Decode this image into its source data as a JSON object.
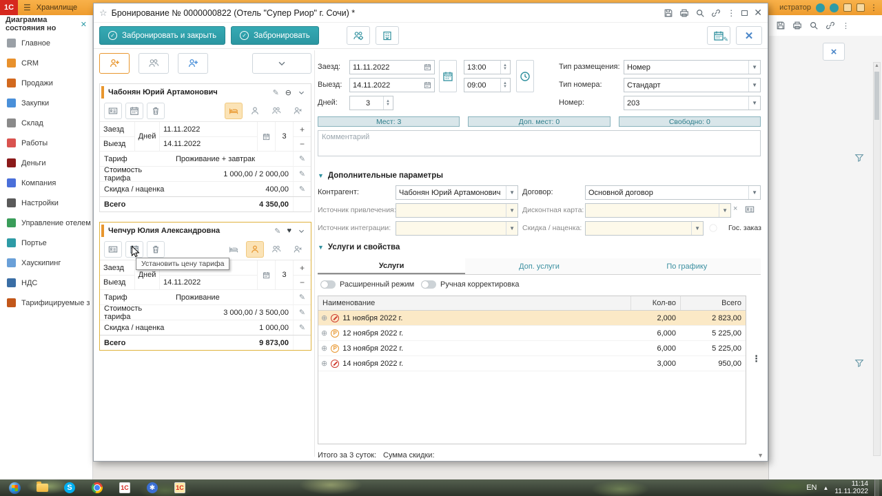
{
  "colors": {
    "accent_teal": "#2e9ba6",
    "brand_orange": "#f2a33c",
    "selection_gold": "#dfb23c",
    "row_highlight": "#fbe9c6",
    "badge_teal": "#2e7d8a"
  },
  "topbar": {
    "logo": "1С",
    "title": "Хранилище",
    "user_fragment": "истратор"
  },
  "bg_window": {
    "title": "Диаграмма состояния но"
  },
  "sidebar": {
    "items": [
      {
        "label": "Главное",
        "icon": "main-menu-icon"
      },
      {
        "label": "CRM",
        "icon": "crm-icon"
      },
      {
        "label": "Продажи",
        "icon": "sales-icon"
      },
      {
        "label": "Закупки",
        "icon": "purchases-icon"
      },
      {
        "label": "Склад",
        "icon": "warehouse-icon"
      },
      {
        "label": "Работы",
        "icon": "works-icon"
      },
      {
        "label": "Деньги",
        "icon": "money-icon"
      },
      {
        "label": "Компания",
        "icon": "company-icon"
      },
      {
        "label": "Настройки",
        "icon": "settings-icon"
      },
      {
        "label": "Управление отелем",
        "icon": "hotel-management-icon"
      },
      {
        "label": "Портье",
        "icon": "reception-icon"
      },
      {
        "label": "Хаускипинг",
        "icon": "housekeeping-icon"
      },
      {
        "label": "НДС",
        "icon": "vat-icon"
      },
      {
        "label": "Тарифицируемые з",
        "icon": "tariff-icon"
      }
    ]
  },
  "dialog": {
    "title": "Бронирование  № 0000000822 (Отель \"Супер Риор\" г. Сочи) *",
    "toolbar": {
      "book_and_close": "Забронировать и закрыть",
      "book": "Забронировать"
    },
    "tooltip": "Установить цену тарифа",
    "guest_fields": {
      "checkin": "Заезд",
      "checkout": "Выезд",
      "days": "Дней",
      "tariff": "Тариф",
      "tariff_cost": "Стоимость тарифа",
      "discount": "Скидка / наценка",
      "total": "Всего"
    },
    "guests": [
      {
        "name": "Чабонян Юрий Артамонович",
        "checkin": "11.11.2022",
        "checkout": "14.11.2022",
        "days": "3",
        "tariff": "Проживание + завтрак",
        "tariff_cost": "1 000,00 / 2 000,00",
        "discount": "400,00",
        "total": "4 350,00"
      },
      {
        "name": "Чепчур Юлия Александровна",
        "checkin": "11.11.2022",
        "checkout": "14.11.2022",
        "days": "3",
        "tariff": "Проживание",
        "tariff_cost": "3 000,00 / 3 500,00",
        "discount": "1 000,00",
        "total": "9 873,00"
      }
    ],
    "form": {
      "checkin_label": "Заезд:",
      "checkin_date": "11.11.2022",
      "checkin_time": "13:00",
      "checkout_label": "Выезд:",
      "checkout_date": "14.11.2022",
      "checkout_time": "09:00",
      "days_label": "Дней:",
      "days": "3",
      "placement_label": "Тип размещения:",
      "placement": "Номер",
      "room_type_label": "Тип номера:",
      "room_type": "Стандарт",
      "room_label": "Номер:",
      "room": "203",
      "badges": [
        "Мест: 3",
        "Доп. мест: 0",
        "Свободно: 0"
      ],
      "comment_placeholder": "Комментарий",
      "params_section": "Дополнительные параметры",
      "contractor_label": "Контрагент:",
      "contractor": "Чабонян Юрий Артамонович",
      "contract_label": "Договор:",
      "contract": "Основной договор",
      "source_label": "Источник привлечения:",
      "discount_card_label": "Дисконтная карта:",
      "integration_label": "Источник интеграции:",
      "discount_label": "Скидка / наценка:",
      "gos_order_label": "Гос. заказ"
    },
    "services": {
      "section": "Услуги и свойства",
      "tabs": [
        "Услуги",
        "Доп. услуги",
        "По графику"
      ],
      "expanded_mode": "Расширенный режим",
      "manual_adjust": "Ручная корректировка",
      "headers": {
        "name": "Наименование",
        "qty": "Кол-во",
        "total": "Всего"
      },
      "rows": [
        {
          "name": "11 ноября 2022 г.",
          "qty": "2,000",
          "total": "2 823,00",
          "marker": "red-no-entry-icon",
          "highlighted": true
        },
        {
          "name": "12 ноября 2022 г.",
          "qty": "6,000",
          "total": "5 225,00",
          "marker": "orange-p-circle-icon",
          "highlighted": false
        },
        {
          "name": "13 ноября 2022 г.",
          "qty": "6,000",
          "total": "5 225,00",
          "marker": "orange-p-circle-icon",
          "highlighted": false
        },
        {
          "name": "14 ноября 2022 г.",
          "qty": "3,000",
          "total": "950,00",
          "marker": "red-no-entry-icon",
          "highlighted": false
        }
      ],
      "footer_total_label": "Итого за 3 суток:",
      "footer_discount_label": "Сумма скидки:"
    }
  },
  "taskbar": {
    "lang": "EN",
    "time": "11:14",
    "date": "11.11.2022"
  }
}
